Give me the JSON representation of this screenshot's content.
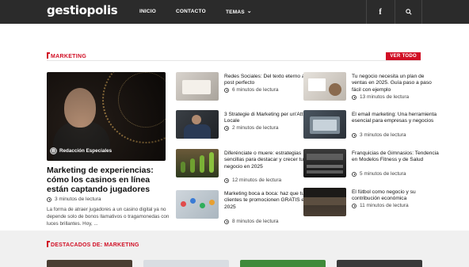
{
  "header": {
    "logo": "gestiopolis",
    "nav": [
      {
        "label": "INICIO"
      },
      {
        "label": "CONTACTO"
      },
      {
        "label": "TEMAS"
      }
    ],
    "icons": [
      "facebook-icon",
      "search-icon"
    ]
  },
  "section": {
    "title": "MARKETING",
    "view_all": "VER TODO"
  },
  "feature": {
    "author": "Redacción Especiales",
    "title": "Marketing de experiencias: cómo los casinos en línea están captando jugadores",
    "read_time": "3 minutos de lectura",
    "excerpt": "La forma de atraer jugadores a un casino digital ya no depende solo de bonos llamativos o tragamonedas con luces brillantes. Hoy, ..."
  },
  "articles": [
    {
      "title": "Redes Sociales: Del texto eterno al post perfecto",
      "read_time": "6 minutos de lectura"
    },
    {
      "title": "3 Strategie di Marketing per un'Attività Locale",
      "read_time": "2 minutos de lectura"
    },
    {
      "title": "Diferénciate o muere: estrategias sencillas para destacar y crecer tu negocio en 2025",
      "read_time": "12 minutos de lectura"
    },
    {
      "title": "Marketing boca a boca: haz que tus clientes te promocionen GRATIS en 2025",
      "read_time": "8 minutos de lectura"
    },
    {
      "title": "Tu negocio necesita un plan de ventas en 2025. Guía paso a paso fácil con ejemplo",
      "read_time": "13 minutos de lectura"
    },
    {
      "title": "El email marketing: Una herramienta esencial para empresas y negocios",
      "read_time": "3 minutos de lectura"
    },
    {
      "title": "Franquicias de Gimnasios: Tendencia en Modelos Fitness y de Salud",
      "read_time": "5 minutos de lectura"
    },
    {
      "title": "El fútbol como negocio y su contribución económica",
      "read_time": "11 minutos de lectura"
    }
  ],
  "section2": {
    "title": "DESTACADOS DE: MARKETING"
  },
  "colors": {
    "accent": "#d10f25",
    "topbar": "#2b2b2b"
  }
}
